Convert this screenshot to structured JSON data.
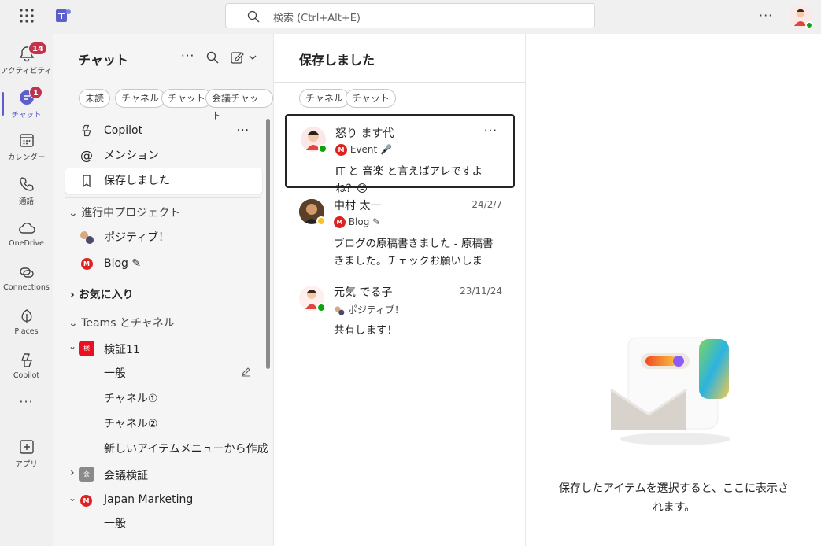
{
  "search": {
    "placeholder": "検索 (Ctrl+Alt+E)"
  },
  "rail": [
    {
      "label": "アクティビティ",
      "badge": "14"
    },
    {
      "label": "チャット",
      "badge": "1"
    },
    {
      "label": "カレンダー"
    },
    {
      "label": "通話"
    },
    {
      "label": "OneDrive"
    },
    {
      "label": "Connections"
    },
    {
      "label": "Places"
    },
    {
      "label": "Copilot"
    },
    {
      "label": "アプリ"
    }
  ],
  "list": {
    "title": "チャット",
    "filters": [
      "未読",
      "チャネル",
      "チャット",
      "会議チャット"
    ],
    "pinned": [
      "Copilot",
      "メンション",
      "保存しました"
    ],
    "group1": "進行中プロジェクト",
    "group1_items": [
      "ポジティブ！",
      "Blog ✎"
    ],
    "favorites": "お気に入り",
    "teams_header": "Teams とチャネル",
    "team1": {
      "name": "検証11",
      "badge": "検",
      "channels": [
        "一般",
        "チャネル①",
        "チャネル②",
        "新しいアイテムメニューから作成"
      ]
    },
    "team2": {
      "name": "会議検証",
      "badge": "会"
    },
    "team3": {
      "name": "Japan Marketing",
      "channels": [
        "一般"
      ]
    }
  },
  "saved": {
    "title": "保存しました",
    "filters": [
      "チャネル",
      "チャット"
    ],
    "messages": [
      {
        "name": "怒り ます代",
        "date": "",
        "context": "Event",
        "text": "IT と 音楽 と言えばアレですよね？😠"
      },
      {
        "name": "中村 太一",
        "date": "24/2/7",
        "context": "Blog ✎",
        "text": "ブログの原稿書きました - 原稿書きました。チェックお願いします。元気 で…"
      },
      {
        "name": "元気 でる子",
        "date": "23/11/24",
        "context": "ポジティブ！",
        "text": "共有します！"
      }
    ]
  },
  "detail": {
    "empty": "保存したアイテムを選択すると、ここに表示されます。"
  },
  "colors": {
    "accent": "#5b5fc7",
    "badge": "#c4314b",
    "available": "#13a10e",
    "away": "#f8c12a"
  }
}
